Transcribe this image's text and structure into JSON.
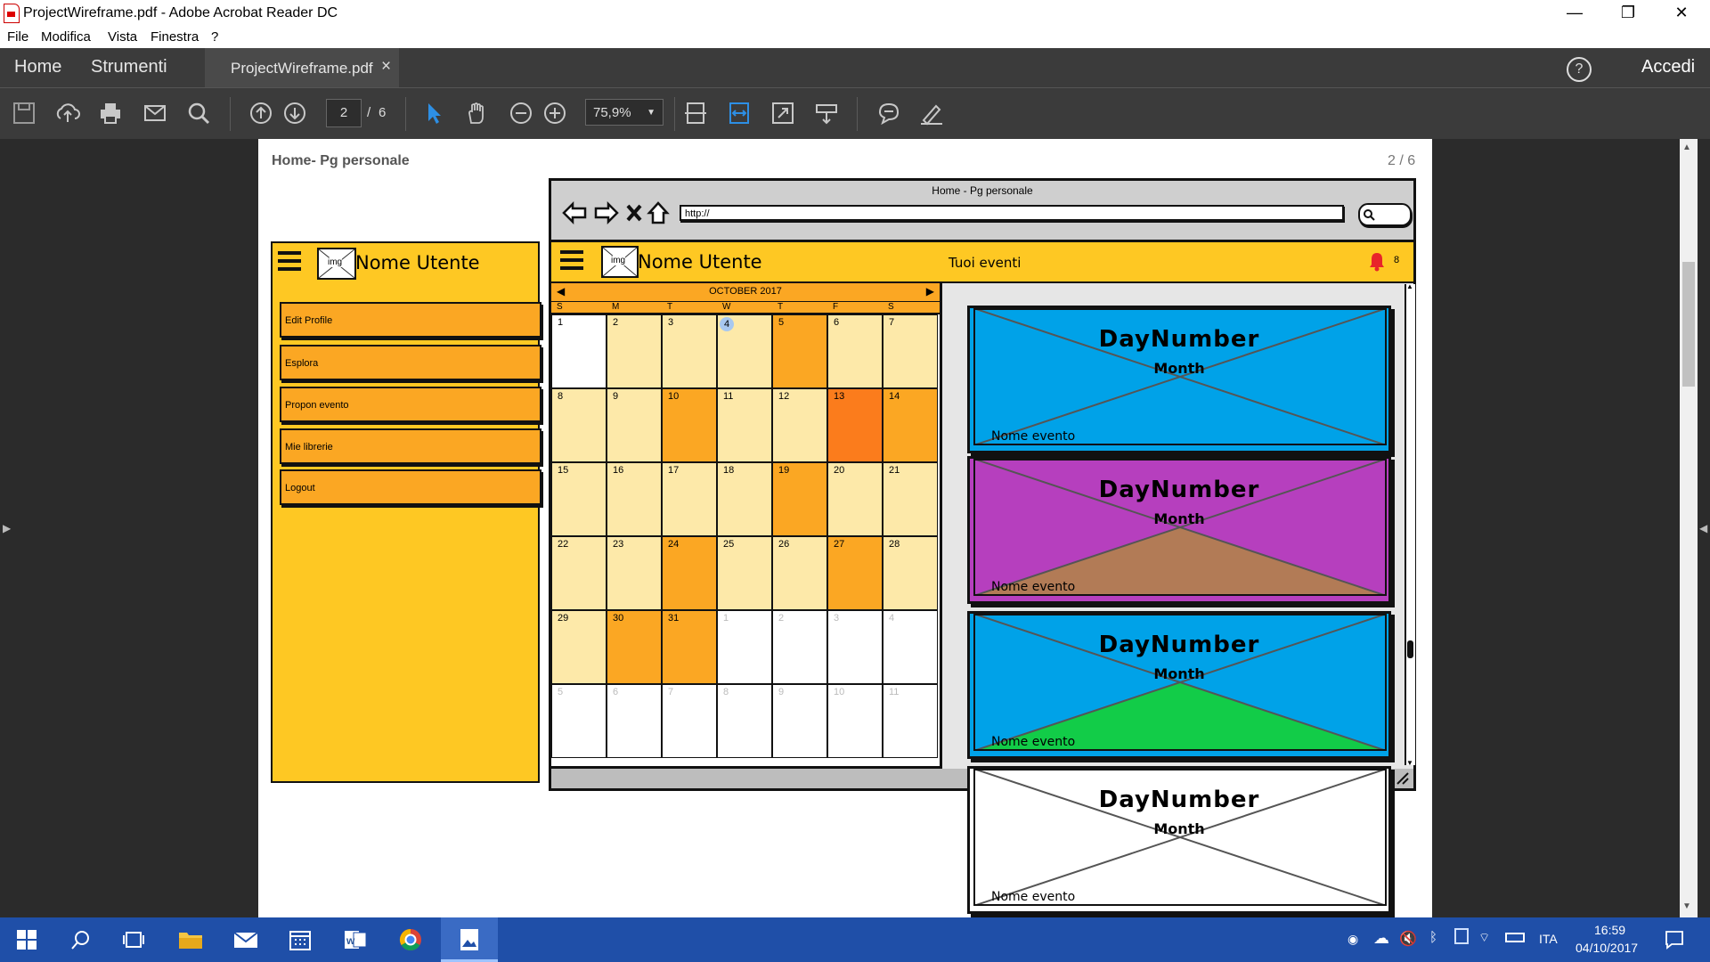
{
  "window": {
    "title": "ProjectWireframe.pdf - Adobe Acrobat Reader DC",
    "minimize": "—",
    "maximize": "❐",
    "close": "✕"
  },
  "menu": [
    "File",
    "Modifica",
    "Vista",
    "Finestra",
    "?"
  ],
  "tabs": {
    "home": "Home",
    "tools": "Strumenti",
    "doc": "ProjectWireframe.pdf",
    "close": "×",
    "help": "?",
    "signin": "Accedi"
  },
  "toolbar": {
    "page_current": "2",
    "page_sep": "/",
    "page_total": "6",
    "zoom": "75,9%"
  },
  "page": {
    "header_left": "Home- Pg personale",
    "header_right": "2 / 6"
  },
  "browser": {
    "title": "Home - Pg personale",
    "url": "http://"
  },
  "sidebar": {
    "img_label": "img",
    "user": "Nome Utente",
    "items": [
      "Edit Profile",
      "Esplora",
      "Propon evento",
      "Mie librerie",
      "Logout"
    ]
  },
  "appbar": {
    "img_label": "img",
    "user": "Nome Utente",
    "events_label": "Tuoi eventi",
    "notif_count": "8"
  },
  "calendar": {
    "month": "OCTOBER 2017",
    "weekdays": [
      "S",
      "M",
      "T",
      "W",
      "T",
      "F",
      "S"
    ],
    "days": [
      [
        "1",
        "2",
        "3",
        "4",
        "5",
        "6",
        "7"
      ],
      [
        "8",
        "9",
        "10",
        "11",
        "12",
        "13",
        "14"
      ],
      [
        "15",
        "16",
        "17",
        "18",
        "19",
        "20",
        "21"
      ],
      [
        "22",
        "23",
        "24",
        "25",
        "26",
        "27",
        "28"
      ],
      [
        "29",
        "30",
        "31",
        "1",
        "2",
        "3",
        "4"
      ],
      [
        "5",
        "6",
        "7",
        "8",
        "9",
        "10",
        "11"
      ]
    ],
    "status": [
      [
        "w",
        "l",
        "l",
        "l",
        "o",
        "l",
        "l"
      ],
      [
        "l",
        "l",
        "o",
        "l",
        "l",
        "r",
        "o"
      ],
      [
        "l",
        "l",
        "l",
        "l",
        "o",
        "l",
        "l"
      ],
      [
        "l",
        "l",
        "o",
        "l",
        "l",
        "o",
        "l"
      ],
      [
        "l",
        "o",
        "o",
        "x",
        "x",
        "x",
        "x"
      ],
      [
        "x",
        "x",
        "x",
        "x",
        "x",
        "x",
        "x"
      ]
    ],
    "colors": {
      "w": "#ffffff",
      "l": "#fde9a9",
      "o": "#fba723",
      "r": "#fb7c1c",
      "x": "#ffffff"
    },
    "today": "4"
  },
  "cards": [
    {
      "day": "DayNumber",
      "month": "Month",
      "name": "Nome evento",
      "bg": "#00a2e8",
      "fill": "none"
    },
    {
      "day": "DayNumber",
      "month": "Month",
      "name": "Nome evento",
      "bg": "#b63fbe",
      "fill": "#b27b56"
    },
    {
      "day": "DayNumber",
      "month": "Month",
      "name": "Nome evento",
      "bg": "#00a2e8",
      "fill": "#12cc48"
    },
    {
      "day": "DayNumber",
      "month": "Month",
      "name": "Nome evento",
      "bg": "#ffffff",
      "fill": "none"
    }
  ],
  "taskbar": {
    "lang": "ITA",
    "time": "16:59",
    "date": "04/10/2017"
  }
}
